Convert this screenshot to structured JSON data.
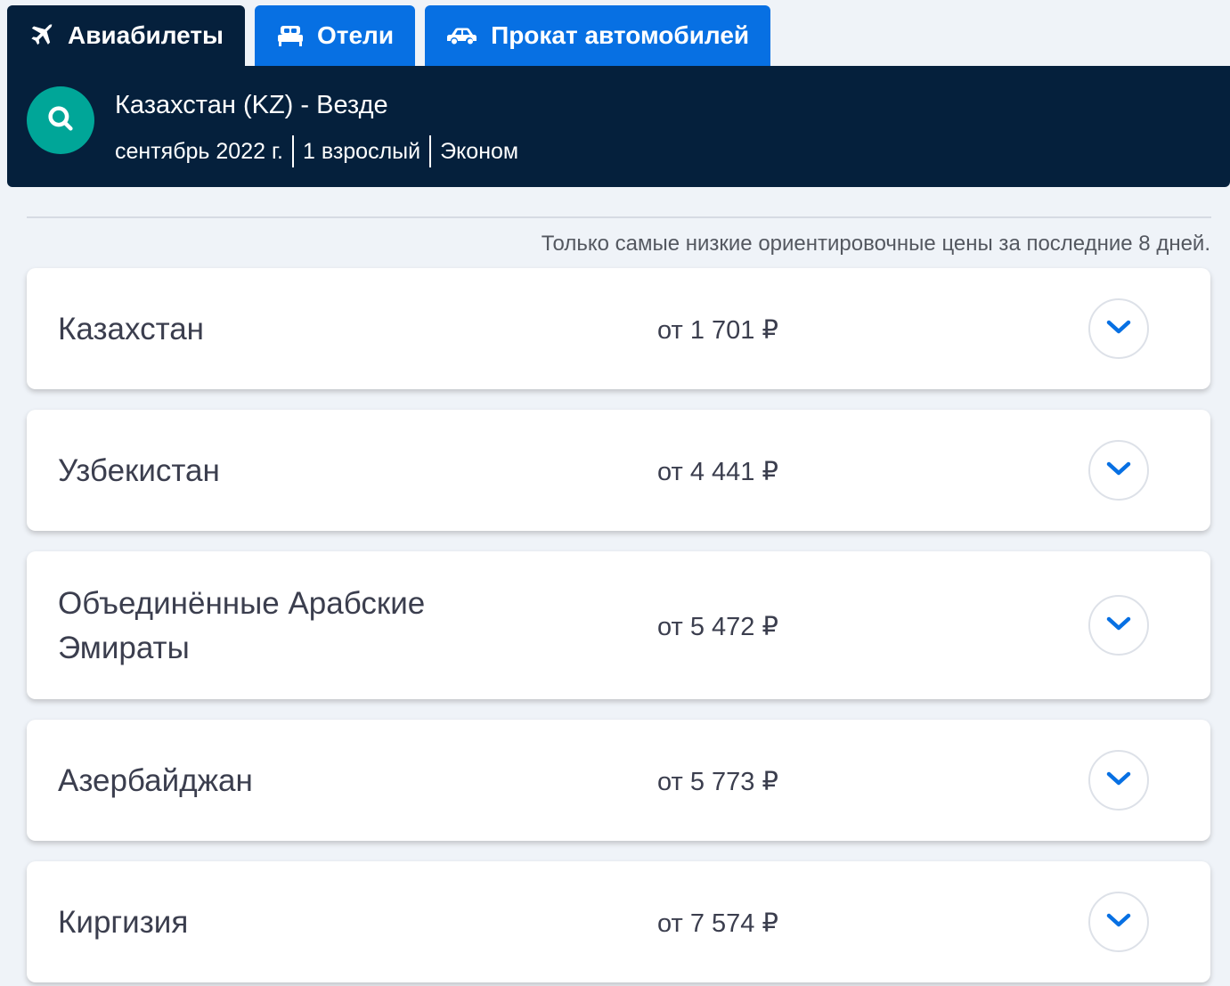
{
  "tabs": [
    {
      "label": "Авиабилеты",
      "icon": "plane-icon",
      "active": true
    },
    {
      "label": "Отели",
      "icon": "bed-icon",
      "active": false
    },
    {
      "label": "Прокат автомобилей",
      "icon": "car-icon",
      "active": false
    }
  ],
  "search": {
    "route": "Казахстан (KZ) - Везде",
    "date": "сентябрь 2022 г.",
    "travellers": "1 взрослый",
    "cabin": "Эконом",
    "icon": "search-icon"
  },
  "note": "Только самые низкие ориентировочные цены за последние 8 дней.",
  "results": [
    {
      "country": "Казахстан",
      "price": "от 1 701 ₽"
    },
    {
      "country": "Узбекистан",
      "price": "от 4 441 ₽"
    },
    {
      "country": "Объединённые Арабские Эмираты",
      "price": "от 5 472 ₽"
    },
    {
      "country": "Азербайджан",
      "price": "от 5 773 ₽"
    },
    {
      "country": "Киргизия",
      "price": "от 7 574 ₽"
    }
  ],
  "colors": {
    "header": "#05203c",
    "tab_inactive": "#0770e3",
    "search_button": "#00a698",
    "chevron": "#0770e3",
    "background": "#eff3f8"
  }
}
